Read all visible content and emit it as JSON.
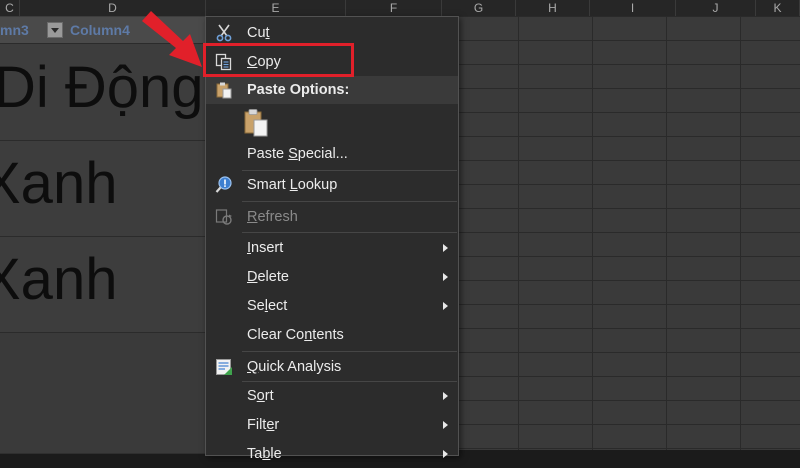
{
  "columns": {
    "headers": [
      "C",
      "D",
      "E",
      "F",
      "G",
      "H",
      "I",
      "J",
      "K"
    ]
  },
  "table": {
    "column3_label": "mn3",
    "column4_label": "Column4",
    "rows": [
      {
        "text": "Di  Động"
      },
      {
        "text": "Xanh"
      },
      {
        "text": "Xanh"
      }
    ]
  },
  "context_menu": {
    "items": [
      {
        "id": "cut",
        "pre": "Cu",
        "accel": "t",
        "post": "",
        "icon": "scissors-icon"
      },
      {
        "id": "copy",
        "pre": "",
        "accel": "C",
        "post": "opy",
        "icon": "copy-icon"
      },
      {
        "id": "paste_options",
        "pre": "",
        "accel": "",
        "post": "Paste Options:",
        "icon": "clipboard-icon"
      },
      {
        "id": "paste_special",
        "pre": "Paste ",
        "accel": "S",
        "post": "pecial...",
        "icon": ""
      },
      {
        "id": "smart_lookup",
        "pre": "Smart ",
        "accel": "L",
        "post": "ookup",
        "icon": "smart-lookup-icon"
      },
      {
        "id": "refresh",
        "pre": "",
        "accel": "R",
        "post": "efresh",
        "icon": "refresh-icon",
        "disabled": true
      },
      {
        "id": "insert",
        "pre": "",
        "accel": "I",
        "post": "nsert",
        "submenu": true
      },
      {
        "id": "delete",
        "pre": "",
        "accel": "D",
        "post": "elete",
        "submenu": true
      },
      {
        "id": "select",
        "pre": "Se",
        "accel": "l",
        "post": "ect",
        "submenu": true
      },
      {
        "id": "clear_contents",
        "pre": "Clear Co",
        "accel": "n",
        "post": "tents"
      },
      {
        "id": "quick_analysis",
        "pre": "",
        "accel": "Q",
        "post": "uick Analysis",
        "icon": "quick-analysis-icon"
      },
      {
        "id": "sort",
        "pre": "S",
        "accel": "o",
        "post": "rt",
        "submenu": true
      },
      {
        "id": "filter",
        "pre": "Filt",
        "accel": "e",
        "post": "r",
        "submenu": true
      },
      {
        "id": "table",
        "pre": "Ta",
        "accel": "b",
        "post": "le",
        "submenu": true
      }
    ]
  },
  "annotation": {
    "highlight_color": "#e1202a",
    "arrow_color": "#e1202a"
  },
  "colors": {
    "menu_bg": "#2c2c2c",
    "header_text": "#5e7aa6"
  }
}
